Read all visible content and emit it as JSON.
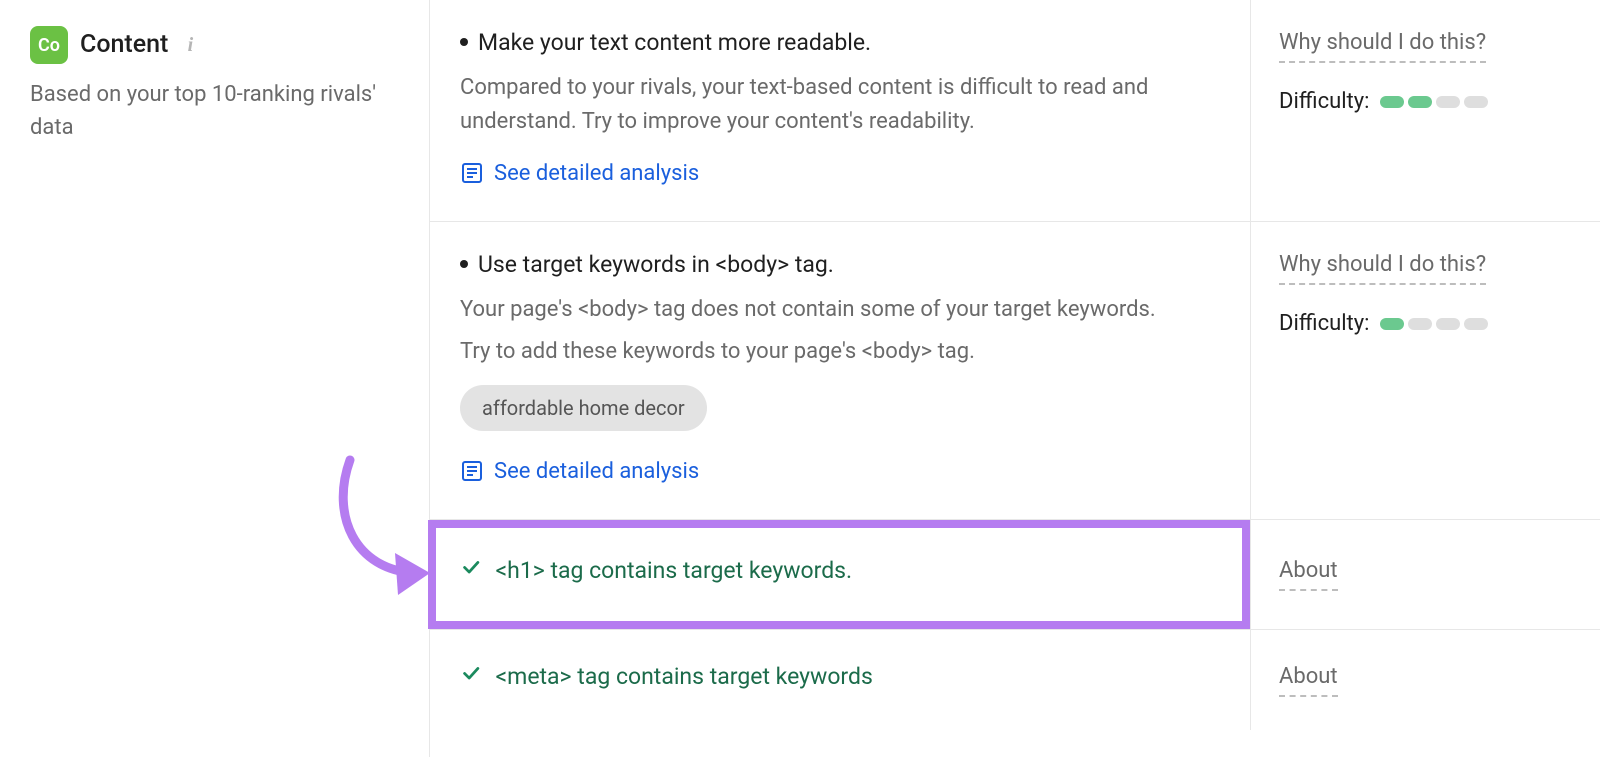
{
  "sidebar": {
    "badge": "Co",
    "title": "Content",
    "subtitle": "Based on your top 10-ranking rivals' data"
  },
  "rows": {
    "readability": {
      "title": "Make your text content more readable.",
      "desc": "Compared to your rivals, your text-based content is difficult to read and understand. Try to improve your content's readability.",
      "why": "Why should I do this?",
      "difficulty_label": "Difficulty:",
      "detail_link": "See detailed analysis"
    },
    "body_keywords": {
      "title": "Use target keywords in <body> tag.",
      "desc1": "Your page's <body> tag does not contain some of your target keywords.",
      "desc2": "Try to add these keywords to your page's <body> tag.",
      "keyword": "affordable home decor",
      "why": "Why should I do this?",
      "difficulty_label": "Difficulty:",
      "detail_link": "See detailed analysis"
    },
    "h1": {
      "text": "<h1> tag contains target keywords.",
      "about": "About"
    },
    "meta": {
      "text": "<meta> tag contains target keywords",
      "about": "About"
    }
  }
}
